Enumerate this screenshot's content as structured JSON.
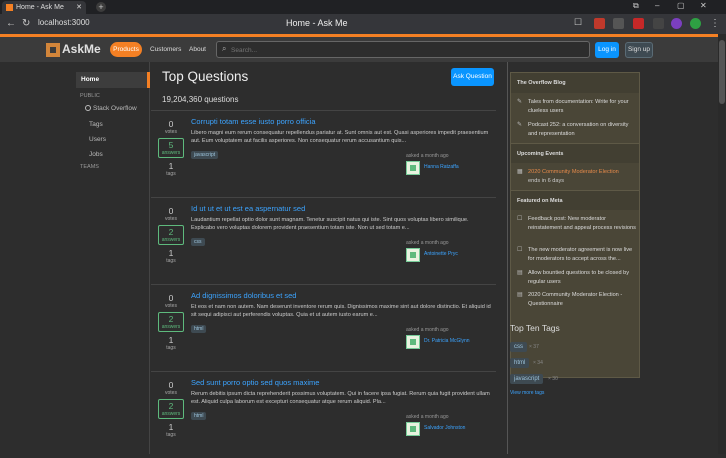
{
  "browser": {
    "tab_title": "Home - Ask Me",
    "new_tab": "+",
    "url": "localhost:3000",
    "page_title": "Home - Ask Me",
    "extensions": [
      "#c0392b",
      "#555",
      "#c62828",
      "#444",
      "#7b3fbf",
      "#2ea043",
      "#c0392b"
    ]
  },
  "header": {
    "logo": "AskMe",
    "nav": [
      "Products",
      "Customers",
      "About"
    ],
    "search_placeholder": "Search...",
    "login": "Log in",
    "signup": "Sign up"
  },
  "sidebar": {
    "home": "Home",
    "public": "PUBLIC",
    "items": [
      "Stack Overflow",
      "Tags",
      "Users",
      "Jobs"
    ],
    "teams": "TEAMS"
  },
  "main": {
    "title": "Top Questions",
    "ask_button": "Ask Question",
    "count": "19,204,360 questions",
    "questions": [
      {
        "votes": "0",
        "votes_label": "votes",
        "answers": "5",
        "answers_label": "answers",
        "tags_count": "1",
        "tags_label": "tags",
        "title": "Corrupti totam esse iusto porro officia",
        "excerpt": "Libero magni eum rerum consequatur repellendus pariatur at. Sunt omnis aut est. Quasi asperiores impedit praesentium aut. Eum voluptatem aut facilis asperiores. Non consequatur rerum accusantium quis...",
        "tag": "javascript",
        "asked": "asked a month ago",
        "user": "Hanna Ratzaffa"
      },
      {
        "votes": "0",
        "votes_label": "votes",
        "answers": "2",
        "answers_label": "answers",
        "tags_count": "1",
        "tags_label": "tags",
        "title": "Id ut ut et ut est ea aspernatur sed",
        "excerpt": "Laudantium repellat optio dolor sunt magnam. Tenetur suscipit natus qui iste. Sint quos voluptas libero similique. Explicabo vero voluptas dolorem provident praesentium totam iste. Non ut sed totam e...",
        "tag": "css",
        "asked": "asked a month ago",
        "user": "Antoinette Pryc"
      },
      {
        "votes": "0",
        "votes_label": "votes",
        "answers": "2",
        "answers_label": "answers",
        "tags_count": "1",
        "tags_label": "tags",
        "title": "Ad dignissimos doloribus et sed",
        "excerpt": "Et eos et nam non autem. Nam deserunt inventore rerum quis. Dignissimos maxime sint aut dolore distinctio. Et aliquid id sit sequi adipisci aut perferendis voluptas. Quia et ut autem iusto earum e...",
        "tag": "html",
        "asked": "asked a month ago",
        "user": "Dr. Patricia McGlynn"
      },
      {
        "votes": "0",
        "votes_label": "votes",
        "answers": "2",
        "answers_label": "answers",
        "tags_count": "1",
        "tags_label": "tags",
        "title": "Sed sunt porro optio sed quos maxime",
        "excerpt": "Rerum debitis ipsum dicta reprehenderit possimus voluptatem. Qui in facere ipsa fugiat. Rerum quia fugit provident ullam est. Aliquid culpa laborum est excepturi consequatur atque rerum aliquid. Pla...",
        "tag": "html",
        "asked": "asked a month ago",
        "user": "Salvador Johnston"
      }
    ]
  },
  "right": {
    "blog_header": "The Overflow Blog",
    "blog_items": [
      "Tales from documentation: Write for your clueless users",
      "Podcast 252: a conversation on diversity and representation"
    ],
    "events_header": "Upcoming Events",
    "event_title": "2020 Community Moderator Election",
    "event_sub": "ends in 6 days",
    "meta_header": "Featured on Meta",
    "meta_items": [
      "Feedback post: New moderator reinstatement and appeal process revisions",
      "The new moderator agreement is now live for moderators to accept across the...",
      "Allow bountied questions to be closed by regular users",
      "2020 Community Moderator Election - Questionnaire"
    ],
    "top_tags_header": "Top Ten Tags",
    "top_tags": [
      {
        "name": "css",
        "count": "× 37"
      },
      {
        "name": "html",
        "count": "× 34"
      },
      {
        "name": "javascript",
        "count": "× 30"
      }
    ],
    "view_more": "View more tags"
  }
}
